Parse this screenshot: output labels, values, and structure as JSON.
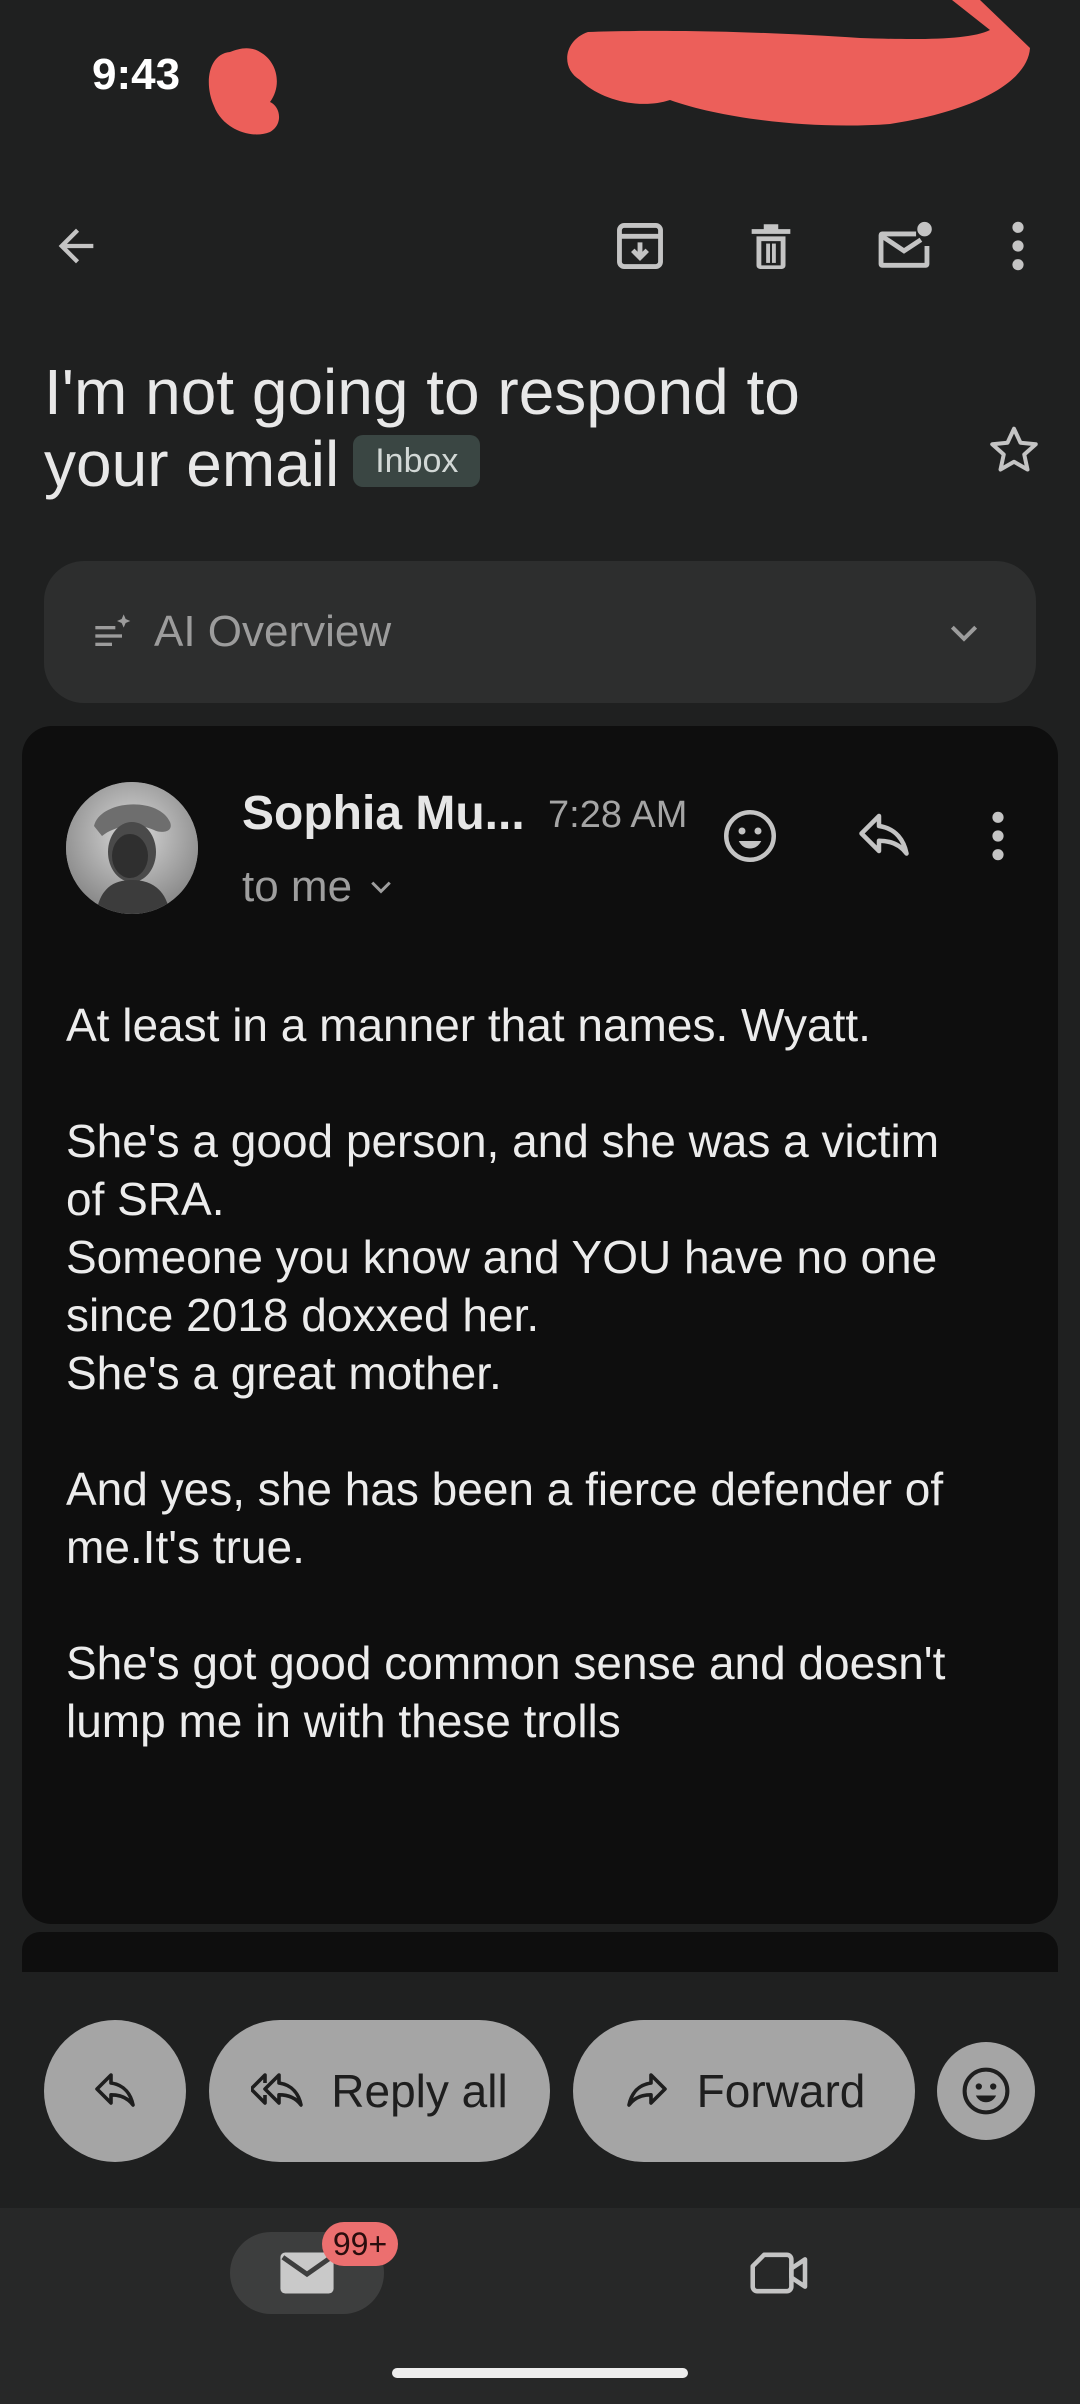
{
  "status_bar": {
    "time": "9:43"
  },
  "toolbar": {
    "back_icon": "arrow-back-icon",
    "archive_icon": "archive-icon",
    "delete_icon": "trash-icon",
    "mark_unread_icon": "mark-unread-icon",
    "more_icon": "more-vert-icon"
  },
  "email": {
    "subject_line1": "I'm not going to respond to",
    "subject_line2": "your email",
    "label": "Inbox",
    "starred": false
  },
  "ai_overview": {
    "label": "AI Overview",
    "expanded": false
  },
  "message": {
    "sender": "Sophia Mu...",
    "time": "7:28 AM",
    "recipient": "to me",
    "body": {
      "p1_l1": "At least in a manner that names. Wyatt.",
      "p2_l1": "She's a good person, and she was a victim",
      "p2_l2": "of SRA.",
      "p2_l3": "Someone you know and YOU have no one",
      "p2_l4": "since 2018 doxxed her.",
      "p2_l5": "She's a great mother.",
      "p3_l1": "And yes, she has been a fierce defender of",
      "p3_l2": "me.It's true.",
      "p4_l1": "She's got good common sense and doesn't",
      "p4_l2": "lump me in with these trolls"
    }
  },
  "actions": {
    "reply_all": "Reply all",
    "forward": "Forward"
  },
  "bottom_nav": {
    "mail_badge": "99+"
  },
  "colors": {
    "background": "#1f2020",
    "card": "#0e0e0e",
    "pill": "#a5a5a5",
    "redaction": "#ec5f5a",
    "badge": "#ec6f6f",
    "inbox_chip": "#3a4643"
  }
}
